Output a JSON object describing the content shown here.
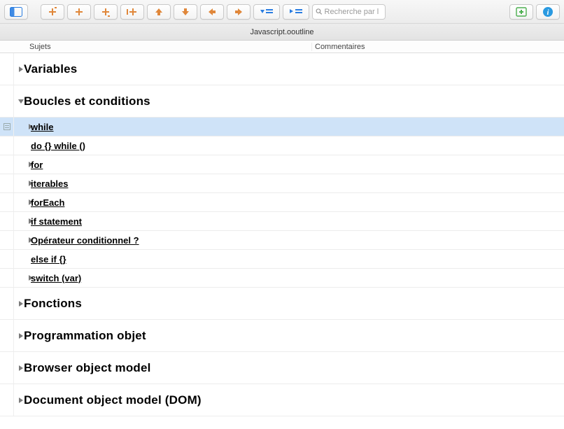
{
  "toolbar": {
    "search_placeholder": "Recherche par l"
  },
  "window": {
    "title": "Javascript.ooutline"
  },
  "columns": {
    "col1": "Sujets",
    "col2": "Commentaires"
  },
  "outline": {
    "sections": [
      {
        "label": "Variables",
        "expanded": false,
        "children": []
      },
      {
        "label": "Boucles et conditions",
        "expanded": true,
        "children": [
          {
            "label": "while",
            "marker": "tri",
            "selected": true
          },
          {
            "label": "do {} while ()",
            "marker": "bullet"
          },
          {
            "label": "for",
            "marker": "tri"
          },
          {
            "label": "iterables",
            "marker": "tri"
          },
          {
            "label": "forEach",
            "marker": "tri"
          },
          {
            "label": "if statement",
            "marker": "tri"
          },
          {
            "label": "Opérateur conditionnel ?",
            "marker": "tri"
          },
          {
            "label": "else if {}",
            "marker": "bullet"
          },
          {
            "label": "switch (var)",
            "marker": "tri"
          }
        ]
      },
      {
        "label": "Fonctions",
        "expanded": false,
        "children": []
      },
      {
        "label": "Programmation objet",
        "expanded": false,
        "children": []
      },
      {
        "label": "Browser object model",
        "expanded": false,
        "children": []
      },
      {
        "label": "Document object model (DOM)",
        "expanded": false,
        "children": []
      }
    ]
  }
}
